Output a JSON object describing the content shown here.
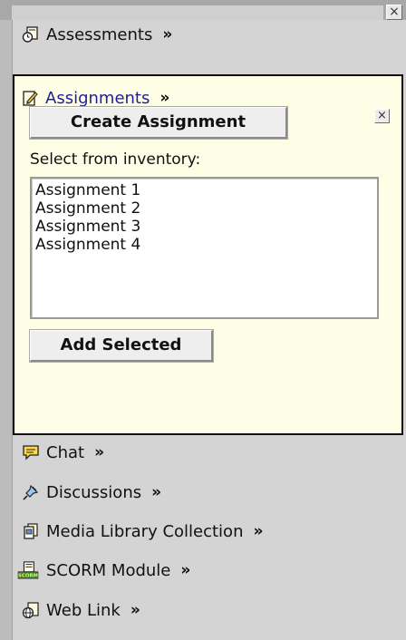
{
  "panel": {
    "close_glyph": "×"
  },
  "tools": {
    "more_glyph": "»",
    "assessments_label": "Assessments",
    "assignments_label": "Assignments",
    "chat_label": "Chat",
    "discussions_label": "Discussions",
    "media_library_label": "Media Library Collection",
    "scorm_label": "SCORM Module",
    "weblink_label": "Web Link"
  },
  "assignments_panel": {
    "create_button_label": "Create Assignment",
    "close_glyph": "×",
    "inventory_label": "Select from inventory:",
    "inventory_items": [
      "Assignment 1",
      "Assignment 2",
      "Assignment 3",
      "Assignment 4"
    ],
    "add_selected_label": "Add Selected"
  },
  "icons": {
    "assessments": "clock-document-icon",
    "assignments": "pencil-document-icon",
    "chat": "speech-bubble-icon",
    "discussions": "pushpin-icon",
    "media_library": "stacked-documents-icon",
    "scorm": "scorm-package-icon",
    "weblink": "globe-document-icon"
  },
  "colors": {
    "panel_background": "#d4d4d4",
    "expanded_background": "#fefee6",
    "expanded_label": "#1e1e9c"
  }
}
